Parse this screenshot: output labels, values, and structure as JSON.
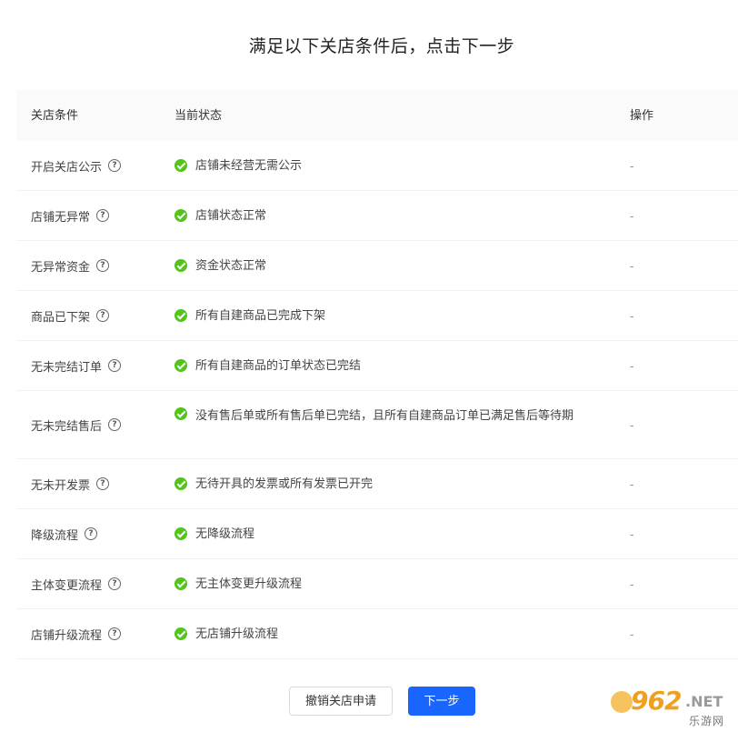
{
  "page": {
    "title": "满足以下关店条件后，点击下一步"
  },
  "table": {
    "headers": {
      "condition": "关店条件",
      "status": "当前状态",
      "operation": "操作"
    },
    "rows": [
      {
        "condition": "开启关店公示",
        "status": "店铺未经营无需公示",
        "operation": "-"
      },
      {
        "condition": "店铺无异常",
        "status": "店铺状态正常",
        "operation": "-"
      },
      {
        "condition": "无异常资金",
        "status": "资金状态正常",
        "operation": "-"
      },
      {
        "condition": "商品已下架",
        "status": "所有自建商品已完成下架",
        "operation": "-"
      },
      {
        "condition": "无未完结订单",
        "status": "所有自建商品的订单状态已完结",
        "operation": "-"
      },
      {
        "condition": "无未完结售后",
        "status": "没有售后单或所有售后单已完结，且所有自建商品订单已满足售后等待期",
        "operation": "-"
      },
      {
        "condition": "无未开发票",
        "status": "无待开具的发票或所有发票已开完",
        "operation": "-"
      },
      {
        "condition": "降级流程",
        "status": "无降级流程",
        "operation": "-"
      },
      {
        "condition": "主体变更流程",
        "status": "无主体变更升级流程",
        "operation": "-"
      },
      {
        "condition": "店铺升级流程",
        "status": "无店铺升级流程",
        "operation": "-"
      }
    ],
    "help_icon_glyph": "?"
  },
  "footer": {
    "cancel_label": "撤销关店申请",
    "next_label": "下一步"
  },
  "watermark": {
    "number": "962",
    "suffix": ".NET",
    "cn": "乐游网"
  },
  "colors": {
    "primary": "#1966ff",
    "success": "#52c41a",
    "header_bg": "#fafafa"
  }
}
